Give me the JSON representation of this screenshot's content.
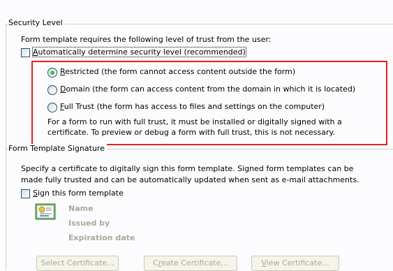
{
  "security": {
    "title": "Security Level",
    "description": "Form template requires the following level of trust from the user:",
    "auto_prefix": "",
    "auto_mnemonic": "A",
    "auto_rest": "utomatically determine security level (recommended)",
    "auto_checked": false,
    "options": [
      {
        "mnemonic": "R",
        "rest": "estricted (the form cannot access content outside the form)",
        "selected": true
      },
      {
        "mnemonic": "D",
        "rest": "omain (the form can access content from the domain in which it is located)",
        "selected": false
      },
      {
        "mnemonic": "F",
        "rest": "ull Trust (the form has access to files and settings on the computer)",
        "selected": false
      }
    ],
    "note_line1": "For a form to run with full trust, it must be installed or digitally signed with a",
    "note_line2": "certificate. To preview or debug a form with full trust, this is not necessary."
  },
  "signature": {
    "title": "Form Template Signature",
    "desc_line1": "Specify a certificate to digitally sign this form template. Signed form templates can be",
    "desc_line2": "made fully trusted and can be automatically updated when sent as e-mail attachments.",
    "sign_mnemonic": "S",
    "sign_rest": "ign this form template",
    "sign_checked": false,
    "cert": {
      "name": "Name",
      "issued_by": "Issued by",
      "expiration": "Expiration date"
    },
    "buttons": {
      "select_pre": "Select Certificate...",
      "create_pre": "C",
      "create_mnemonic": "r",
      "create_post": "eate Certificate...",
      "view_mnemonic": "V",
      "view_rest": "iew Certificate..."
    }
  },
  "colors": {
    "highlight_border": "#e3201b",
    "radio_dot": "#21a121",
    "disabled_text": "#aca899"
  }
}
